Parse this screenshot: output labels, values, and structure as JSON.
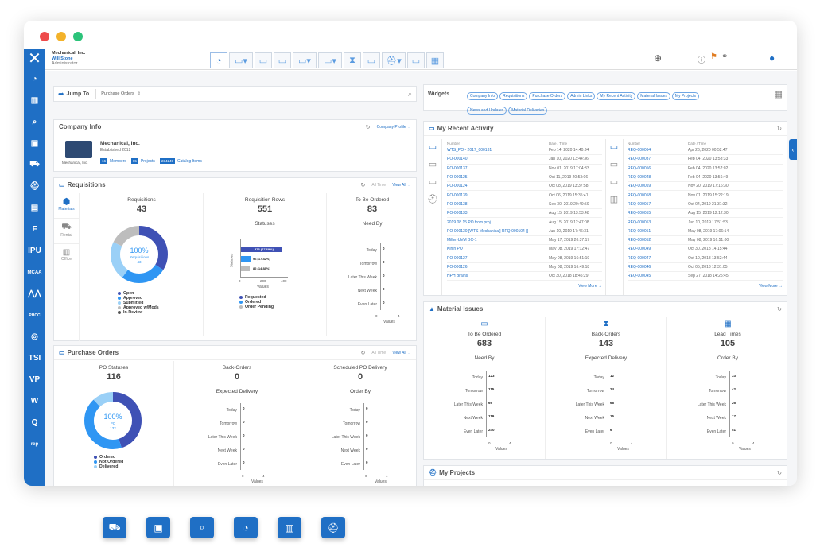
{
  "colors": {
    "brand": "#1f6fc5",
    "dot_red": "#ee4b4b",
    "dot_yellow": "#f3b22a",
    "dot_green": "#2cc37a",
    "donut_dark": "#3f51b5",
    "donut_blue": "#2f96f3",
    "donut_light": "#9ad0f7",
    "donut_gray": "#bdbdbd"
  },
  "company": {
    "name": "Mechanical, Inc.",
    "user": "Will Stone",
    "role": "Administrator"
  },
  "sidebar": {
    "items": [
      "gauge-icon",
      "building-icon",
      "search-icon",
      "contacts-icon",
      "forklift-icon",
      "hardhat-icon",
      "book-icon",
      "brand-f",
      "IPU",
      "MCAA",
      "brand-m",
      "PHCC",
      "brand-o",
      "TSI",
      "VP",
      "brand-w",
      "brand-q",
      "rep"
    ]
  },
  "jump": {
    "label": "Jump To",
    "placeholder": "Purchase Orders"
  },
  "widgets": {
    "title": "Widgets",
    "pills": [
      "Company Info",
      "Requisitions",
      "Purchase Orders",
      "Admin Links",
      "My Recent Activity",
      "Material Issues",
      "My Projects",
      "News and Updates",
      "Material Deliveries"
    ]
  },
  "company_info": {
    "title": "Company Info",
    "link": "Company Profile →",
    "name": "Mechanical, Inc.",
    "est": "Established 2012",
    "logo_caption": "Mechanical, Inc.",
    "members_n": "16",
    "members": "Members",
    "projects_n": "65",
    "projects": "Projects",
    "catalog_n": "234249",
    "catalog": "Catalog Items"
  },
  "requisitions": {
    "title": "Requisitions",
    "filter": "All Time",
    "view_all": "View All →",
    "side": [
      "Materials",
      "Rental",
      "Office"
    ],
    "c1_title": "Requisitions",
    "c1_value": "43",
    "donut_pct": "100%",
    "donut_label": "Requisitions",
    "donut_n": "43",
    "legend": [
      "Open",
      "Approved",
      "Submitted",
      "Approved w/Mods",
      "In-Review"
    ],
    "c2_title": "Requisition Rows",
    "c2_value": "551",
    "c2_sub": "Statuses",
    "c2_xlabel": "Values",
    "c2_ylabel": "Statuses",
    "c2_ticks": [
      "0",
      "200",
      "400"
    ],
    "c2_bars": [
      "373 (67.69%)",
      "96 (17.42%)",
      "82 (14.88%)"
    ],
    "c2_legend": [
      "Requested",
      "Ordered",
      "Order Pending"
    ],
    "c3_title": "To Be Ordered",
    "c3_value": "83",
    "c3_sub": "Need By",
    "c3_xlabel": "Values",
    "c3_ticks": [
      "0",
      "4"
    ]
  },
  "need_by_labels": [
    "Today",
    "Tomorrow",
    "Later This Week",
    "Next Week",
    "Even Later"
  ],
  "zeros": [
    "0",
    "0",
    "0",
    "0",
    "0"
  ],
  "purchase_orders": {
    "title": "Purchase Orders",
    "filter": "All Time",
    "view_all": "View All →",
    "c1_title": "PO Statuses",
    "c1_value": "116",
    "donut_pct": "100%",
    "donut_label": "PO",
    "donut_n": "132",
    "legend": [
      "Ordered",
      "Not Ordered",
      "Delivered"
    ],
    "c2_title": "Back-Orders",
    "c2_value": "0",
    "c2_sub": "Expected Delivery",
    "c3_title": "Scheduled PO Delivery",
    "c3_value": "0",
    "c3_sub": "Order By",
    "xlabel": "Values",
    "ticks": [
      "0",
      "4"
    ]
  },
  "recent": {
    "title": "My Recent Activity",
    "col_num": "Number",
    "col_dt": "Date / Time",
    "view_more": "View More →",
    "left": [
      [
        "WTS_PO - 2017_000131",
        "Feb 14, 2020 14:40:34"
      ],
      [
        "PO-000140",
        "Jan 10, 2020 13:44:36"
      ],
      [
        "PO-000137",
        "Nov 01, 2019 17:04:33"
      ],
      [
        "PO-000125",
        "Oct 11, 2019 20:53:06"
      ],
      [
        "PO-000124",
        "Oct 08, 2019 13:37:58"
      ],
      [
        "PO-000139",
        "Oct 06, 2019 15:35:41"
      ],
      [
        "PO-000138",
        "Sep 30, 2019 20:49:59"
      ],
      [
        "PO-000133",
        "Aug 15, 2019 13:53:48"
      ],
      [
        "2019 08 15 PO from proj",
        "Aug 15, 2019 12:47:08"
      ],
      [
        "PO-000130 [WTS Mechanical] RFQ-000104 []",
        "Jun 10, 2019 17:46:31"
      ],
      [
        "Miller-UVM BC-1",
        "May 17, 2019 20:37:17"
      ],
      [
        "Kirlin PO",
        "May 08, 2019 17:12:47"
      ],
      [
        "PO-000127",
        "May 08, 2019 16:51:19"
      ],
      [
        "PO-000126",
        "May 08, 2019 16:49:18"
      ],
      [
        "HPH Brains",
        "Oct 30, 2018 18:45:29"
      ]
    ],
    "right": [
      [
        "REQ-000064",
        "Apr 26, 2020 00:52:47"
      ],
      [
        "REQ-000037",
        "Feb 04, 2020 13:58:33"
      ],
      [
        "REQ-000056",
        "Feb 04, 2020 13:57:02"
      ],
      [
        "REQ-000048",
        "Feb 04, 2020 13:56:49"
      ],
      [
        "REQ-000059",
        "Nov 20, 2019 17:16:30"
      ],
      [
        "REQ-000058",
        "Nov 01, 2019 15:22:19"
      ],
      [
        "REQ-000057",
        "Oct 04, 2019 21:31:32"
      ],
      [
        "REQ-000055",
        "Aug 15, 2019 12:12:30"
      ],
      [
        "REQ-000053",
        "Jun 10, 2019 17:51:53"
      ],
      [
        "REQ-000051",
        "May 08, 2019 17:06:14"
      ],
      [
        "REQ-000052",
        "May 08, 2019 16:51:00"
      ],
      [
        "REQ-000049",
        "Oct 30, 2018 14:15:44"
      ],
      [
        "REQ-000047",
        "Oct 10, 2018 13:52:44"
      ],
      [
        "REQ-000046",
        "Oct 05, 2018 12:31:05"
      ],
      [
        "REQ-000045",
        "Sep 27, 2018 14:25:45"
      ]
    ]
  },
  "material_issues": {
    "title": "Material Issues",
    "cols": [
      {
        "title": "To Be Ordered",
        "value": "683",
        "sub": "Need By",
        "vals": [
          "123",
          "115",
          "69",
          "119",
          "240"
        ]
      },
      {
        "title": "Back-Orders",
        "value": "143",
        "sub": "Expected Delivery",
        "vals": [
          "12",
          "24",
          "68",
          "15",
          "6"
        ]
      },
      {
        "title": "Lead Times",
        "value": "105",
        "sub": "Order By",
        "vals": [
          "33",
          "42",
          "26",
          "17",
          "51"
        ]
      }
    ],
    "xlabel": "Values",
    "ticks": [
      "0",
      "4"
    ]
  },
  "projects": {
    "title": "My Projects"
  }
}
